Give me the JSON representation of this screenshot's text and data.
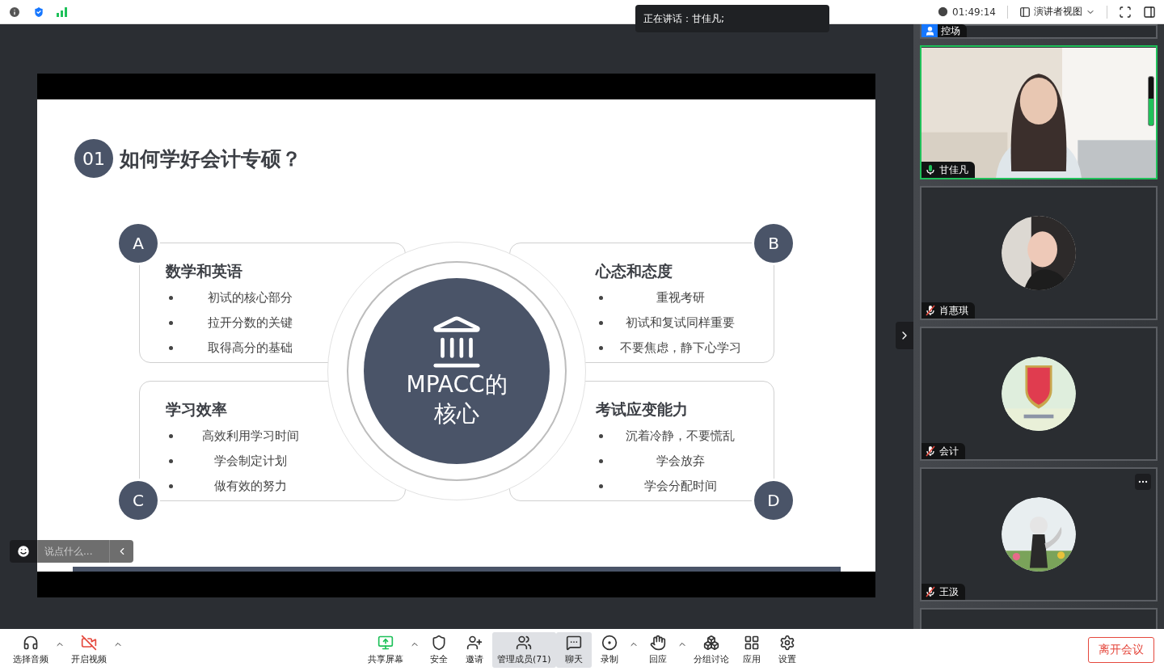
{
  "top_bar": {
    "time": "01:49:14",
    "view_label": "演讲者视图"
  },
  "speaking_banner": {
    "text": "正在讲话：甘佳凡;"
  },
  "slide": {
    "number": "01",
    "title": "如何学好会计专硕？",
    "center_label": [
      "MPACC的",
      "核心"
    ],
    "quadrants": [
      {
        "badge": "A",
        "heading": "数学和英语",
        "bullets": [
          "初试的核心部分",
          "拉开分数的关键",
          "取得高分的基础"
        ]
      },
      {
        "badge": "B",
        "heading": "心态和态度",
        "bullets": [
          "重视考研",
          "初试和复试同样重要",
          "不要焦虑，静下心学习"
        ]
      },
      {
        "badge": "C",
        "heading": "学习效率",
        "bullets": [
          "高效利用学习时间",
          "学会制定计划",
          "做有效的努力"
        ]
      },
      {
        "badge": "D",
        "heading": "考试应变能力",
        "bullets": [
          "沉着冷静，不要慌乱",
          "学会放弃",
          "学会分配时间"
        ]
      }
    ]
  },
  "chat_input": {
    "placeholder": "说点什么..."
  },
  "participants": [
    {
      "kind": "partial_top",
      "name": "控场",
      "host": true,
      "speaking": false
    },
    {
      "kind": "video",
      "name": "甘佳凡",
      "muted": false,
      "speaking": true,
      "level": 0.55
    },
    {
      "kind": "avatar",
      "name": "肖惠琪",
      "muted": true,
      "speaking": false
    },
    {
      "kind": "avatar",
      "name": "会计",
      "muted": true,
      "speaking": false
    },
    {
      "kind": "avatar",
      "name": "王汲",
      "muted": true,
      "speaking": false,
      "show_more": true
    },
    {
      "kind": "partial_bottom"
    }
  ],
  "toolbar": {
    "left": [
      {
        "kind": "tool",
        "label": "选择音频",
        "selected": false
      },
      {
        "kind": "caret"
      },
      {
        "kind": "tool",
        "label": "开启视频",
        "selected": false
      },
      {
        "kind": "caret"
      }
    ],
    "center": [
      {
        "kind": "tool",
        "label": "共享屏幕",
        "selected": false
      },
      {
        "kind": "caret"
      },
      {
        "kind": "tool",
        "label": "安全",
        "selected": false
      },
      {
        "kind": "tool",
        "label": "邀请",
        "selected": false
      },
      {
        "kind": "tool",
        "label": "管理成员(71)",
        "selected": true
      },
      {
        "kind": "tool",
        "label": "聊天",
        "selected": true
      },
      {
        "kind": "tool",
        "label": "录制",
        "selected": false
      },
      {
        "kind": "caret"
      },
      {
        "kind": "tool",
        "label": "回应",
        "selected": false
      },
      {
        "kind": "caret"
      },
      {
        "kind": "tool",
        "label": "分组讨论",
        "selected": false
      },
      {
        "kind": "tool",
        "label": "应用",
        "selected": false
      },
      {
        "kind": "tool",
        "label": "设置",
        "selected": false
      }
    ],
    "leave_button": "离开会议"
  }
}
